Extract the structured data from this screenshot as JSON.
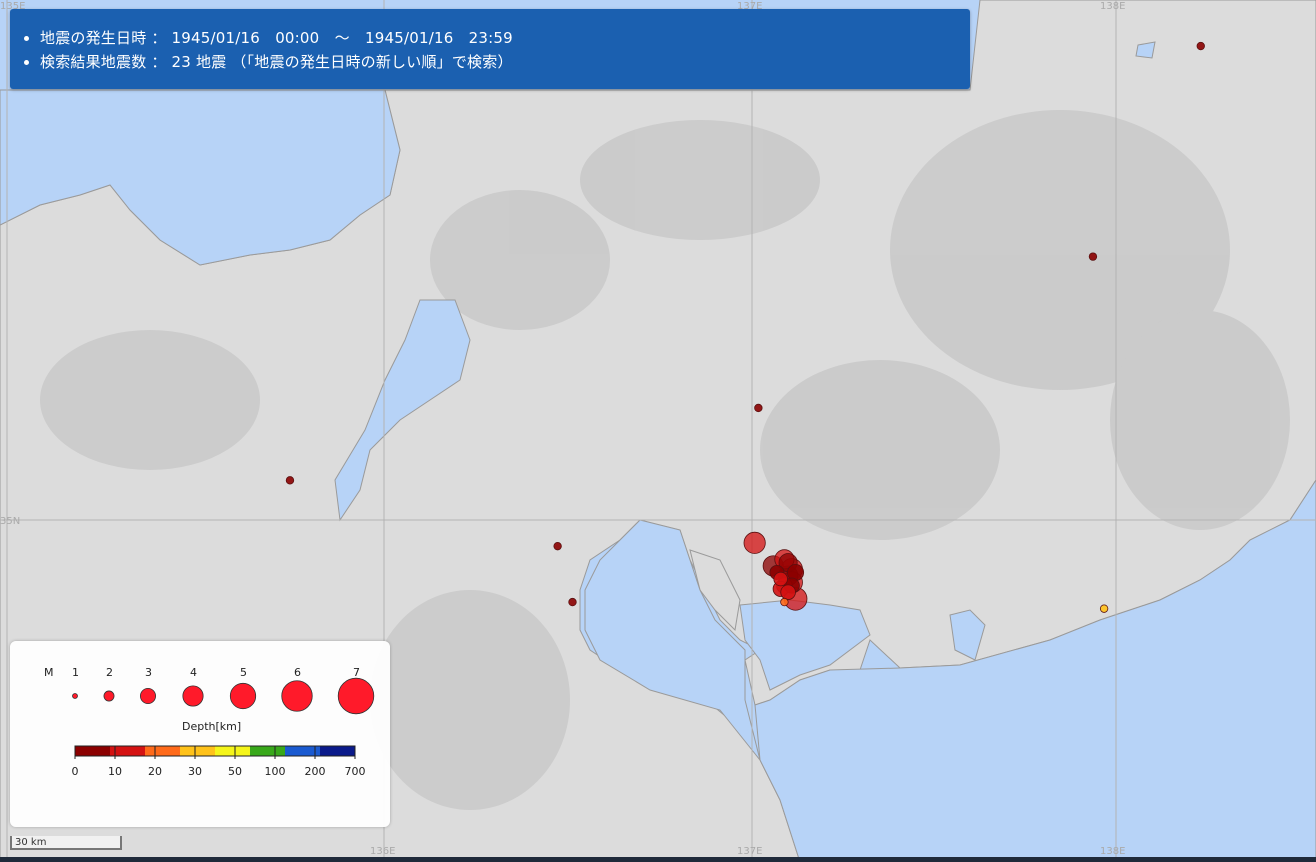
{
  "info": {
    "line1": "地震の発生日時 ： 1945/01/16　00:00　～　1945/01/16　23:59",
    "line2": "検索結果地震数 ： 23 地震 （「地震の発生日時の新しい順」で検索）"
  },
  "grid": {
    "lon_labels": [
      "135E",
      "136E",
      "137E",
      "138E"
    ],
    "lat_labels": [
      "35N"
    ]
  },
  "legend": {
    "magnitude_label": "M",
    "magnitudes": [
      "1",
      "2",
      "3",
      "4",
      "5",
      "6",
      "7"
    ],
    "depth_title": "Depth[km]",
    "depth_ticks": [
      "0",
      "10",
      "20",
      "30",
      "50",
      "100",
      "200",
      "700"
    ],
    "depth_colors": [
      "#8b0000",
      "#d41212",
      "#ff6a1a",
      "#ffc21a",
      "#f5f51a",
      "#38a81a",
      "#1a5ad0",
      "#0a1a8a"
    ]
  },
  "scale_bar": {
    "label": "30 km"
  },
  "chart_data": {
    "type": "scatter",
    "x_unit": "longitude",
    "y_unit": "latitude",
    "xlim": [
      134.9,
      138.44
    ],
    "ylim": [
      33.86,
      36.48
    ],
    "events": [
      {
        "lon": 138.13,
        "lat": 36.34,
        "depth": 5,
        "mag": 1.5
      },
      {
        "lon": 137.84,
        "lat": 35.7,
        "depth": 5,
        "mag": 1.5
      },
      {
        "lon": 136.94,
        "lat": 35.24,
        "depth": 5,
        "mag": 1.5
      },
      {
        "lon": 135.68,
        "lat": 35.02,
        "depth": 5,
        "mag": 1.5
      },
      {
        "lon": 136.4,
        "lat": 34.82,
        "depth": 5,
        "mag": 1.5
      },
      {
        "lon": 136.44,
        "lat": 34.65,
        "depth": 5,
        "mag": 1.5
      },
      {
        "lon": 136.93,
        "lat": 34.83,
        "depth": 15,
        "mag": 4.2
      },
      {
        "lon": 136.98,
        "lat": 34.76,
        "depth": 8,
        "mag": 4.0
      },
      {
        "lon": 137.01,
        "lat": 34.78,
        "depth": 12,
        "mag": 3.8
      },
      {
        "lon": 137.02,
        "lat": 34.77,
        "depth": 6,
        "mag": 3.6
      },
      {
        "lon": 137.03,
        "lat": 34.75,
        "depth": 10,
        "mag": 4.2
      },
      {
        "lon": 137.02,
        "lat": 34.73,
        "depth": 8,
        "mag": 3.9
      },
      {
        "lon": 137.03,
        "lat": 34.71,
        "depth": 13,
        "mag": 4.2
      },
      {
        "lon": 137.04,
        "lat": 34.66,
        "depth": 15,
        "mag": 4.5
      },
      {
        "lon": 137.0,
        "lat": 34.69,
        "depth": 11,
        "mag": 3.0
      },
      {
        "lon": 136.99,
        "lat": 34.74,
        "depth": 9,
        "mag": 2.8
      },
      {
        "lon": 137.04,
        "lat": 34.74,
        "depth": 7,
        "mag": 3.2
      },
      {
        "lon": 137.01,
        "lat": 34.7,
        "depth": 14,
        "mag": 3.1
      },
      {
        "lon": 137.02,
        "lat": 34.68,
        "depth": 12,
        "mag": 2.9
      },
      {
        "lon": 137.0,
        "lat": 34.72,
        "depth": 10,
        "mag": 2.7
      },
      {
        "lon": 137.03,
        "lat": 34.7,
        "depth": 9,
        "mag": 3.0
      },
      {
        "lon": 137.01,
        "lat": 34.65,
        "depth": 20,
        "mag": 1.5
      },
      {
        "lon": 137.87,
        "lat": 34.63,
        "depth": 30,
        "mag": 1.5
      }
    ]
  }
}
